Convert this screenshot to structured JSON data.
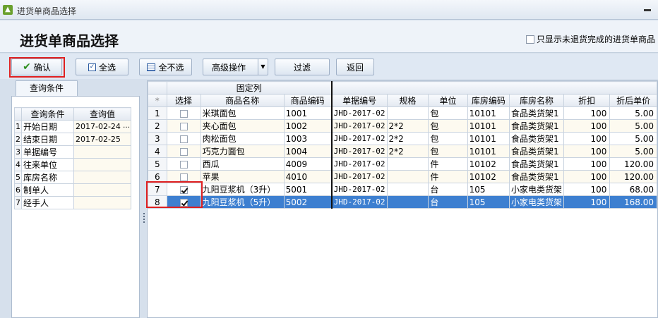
{
  "window": {
    "title": "进货单商品选择"
  },
  "header": {
    "title": "进货单商品选择",
    "only_unreturned_label": "只显示未退货完成的进货单商品"
  },
  "toolbar": {
    "confirm": "确认",
    "select_all": "全选",
    "deselect_all": "全不选",
    "advanced": "高级操作",
    "filter": "过滤",
    "back": "返回"
  },
  "query": {
    "tab": "查询条件",
    "col_condition": "查询条件",
    "col_value": "查询值",
    "rows": [
      {
        "n": "1",
        "label": "开始日期",
        "value": "2017-02-24"
      },
      {
        "n": "2",
        "label": "结束日期",
        "value": "2017-02-25"
      },
      {
        "n": "3",
        "label": "单据编号",
        "value": ""
      },
      {
        "n": "4",
        "label": "往来单位",
        "value": ""
      },
      {
        "n": "5",
        "label": "库房名称",
        "value": ""
      },
      {
        "n": "6",
        "label": "制单人",
        "value": ""
      },
      {
        "n": "7",
        "label": "经手人",
        "value": ""
      }
    ]
  },
  "grid": {
    "fixed_group": "固定列",
    "star": "*",
    "cols": {
      "select": "选择",
      "name": "商品名称",
      "code": "商品编码",
      "bill_no": "单据编号",
      "spec": "规格",
      "unit": "单位",
      "wh_code": "库房编码",
      "wh_name": "库房名称",
      "discount": "折扣",
      "price": "折后单价"
    },
    "rows": [
      {
        "n": "1",
        "checked": false,
        "name": "米琪面包",
        "code": "1001",
        "bill": "JHD-2017-02",
        "spec": "",
        "unit": "包",
        "whc": "10101",
        "whn": "食品类货架1",
        "disc": "100",
        "price": "5.00"
      },
      {
        "n": "2",
        "checked": false,
        "name": "夹心面包",
        "code": "1002",
        "bill": "JHD-2017-02",
        "spec": "2*2",
        "unit": "包",
        "whc": "10101",
        "whn": "食品类货架1",
        "disc": "100",
        "price": "5.00"
      },
      {
        "n": "3",
        "checked": false,
        "name": "肉松面包",
        "code": "1003",
        "bill": "JHD-2017-02",
        "spec": "2*2",
        "unit": "包",
        "whc": "10101",
        "whn": "食品类货架1",
        "disc": "100",
        "price": "5.00"
      },
      {
        "n": "4",
        "checked": false,
        "name": "巧克力面包",
        "code": "1004",
        "bill": "JHD-2017-02",
        "spec": "2*2",
        "unit": "包",
        "whc": "10101",
        "whn": "食品类货架1",
        "disc": "100",
        "price": "5.00"
      },
      {
        "n": "5",
        "checked": false,
        "name": "西瓜",
        "code": "4009",
        "bill": "JHD-2017-02",
        "spec": "",
        "unit": "件",
        "whc": "10102",
        "whn": "食品类货架1",
        "disc": "100",
        "price": "120.00"
      },
      {
        "n": "6",
        "checked": false,
        "name": "苹果",
        "code": "4010",
        "bill": "JHD-2017-02",
        "spec": "",
        "unit": "件",
        "whc": "10102",
        "whn": "食品类货架1",
        "disc": "100",
        "price": "120.00"
      },
      {
        "n": "7",
        "checked": true,
        "name": "九阳豆浆机（3升）",
        "code": "5001",
        "bill": "JHD-2017-02",
        "spec": "",
        "unit": "台",
        "whc": "105",
        "whn": "小家电类货架",
        "disc": "100",
        "price": "68.00"
      },
      {
        "n": "8",
        "checked": true,
        "name": "九阳豆浆机（5升）",
        "code": "5002",
        "bill": "JHD-2017-02",
        "spec": "",
        "unit": "台",
        "whc": "105",
        "whn": "小家电类货架",
        "disc": "100",
        "price": "168.00"
      }
    ]
  }
}
